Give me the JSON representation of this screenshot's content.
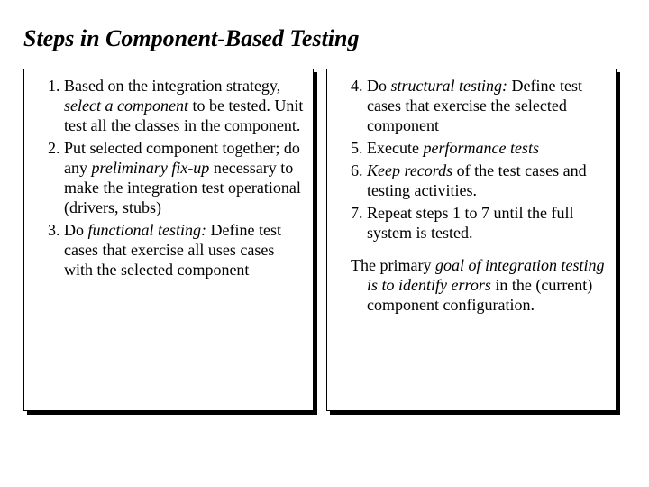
{
  "title": "Steps in Component-Based Testing",
  "left": {
    "s1a": "1. Based on the integration strategy, ",
    "s1b": "select a component",
    "s1c": " to be tested. Unit test all the classes in the component.",
    "s2a": "2. Put selected component together; do any ",
    "s2b": "preliminary fix-up",
    "s2c": " necessary to make the integration test operational (drivers, stubs)",
    "s3a": "3. Do ",
    "s3b": "functional testing:",
    "s3c": " Define test cases that exercise all uses cases with the selected component"
  },
  "right": {
    "s4a": "4. Do ",
    "s4b": "structural testing:",
    "s4c": " Define test cases that exercise the selected component",
    "s5a": "5. Execute ",
    "s5b": "performance tests",
    "s6a": "6. ",
    "s6b": "Keep records",
    "s6c": " of the test cases and testing activities.",
    "s7": "7. Repeat steps 1  to 7 until the full system is tested.",
    "p1": "The primary ",
    "p2": "goal of integration testing is to identify errors",
    "p3": " in the (current) component configuration."
  }
}
